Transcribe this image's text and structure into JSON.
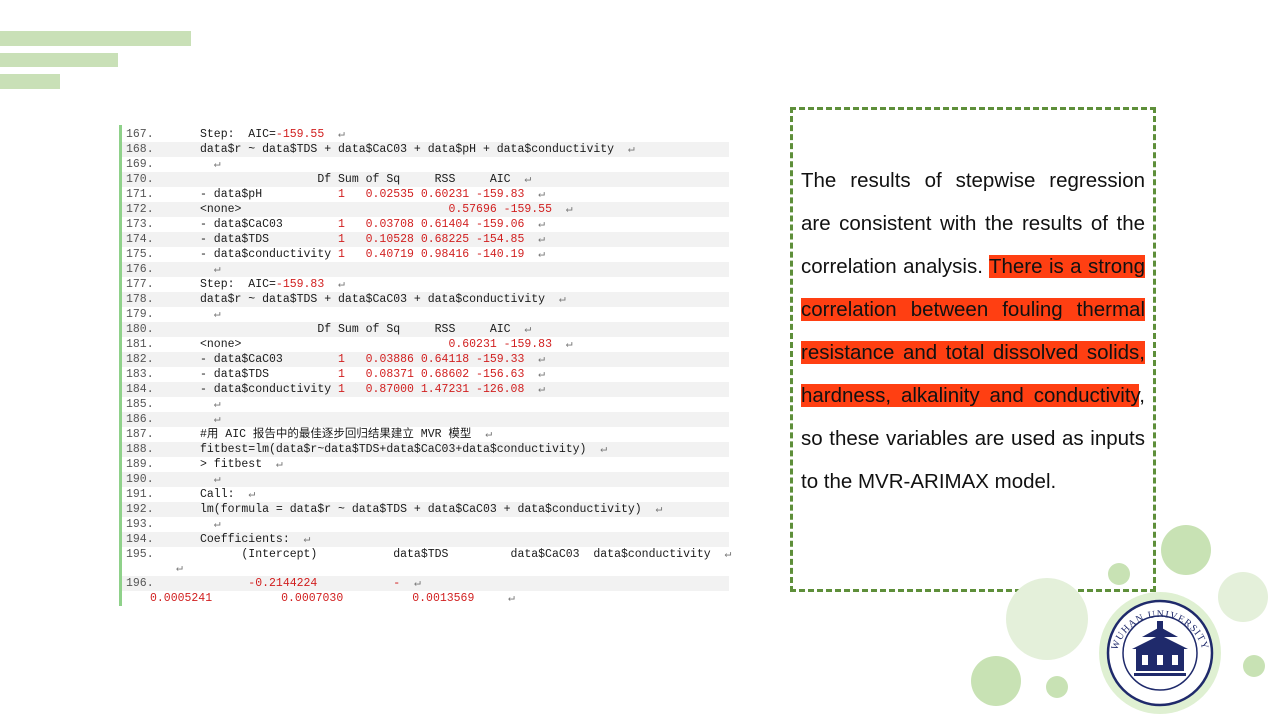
{
  "code_listing": {
    "lines": [
      {
        "num": "167.",
        "text": "Step:  AIC=",
        "red": "-159.55",
        "indent": 0
      },
      {
        "num": "168.",
        "text": "data$r ~ data$TDS + data$CaC03 + data$pH + data$conductivity",
        "indent": 0
      },
      {
        "num": "169.",
        "text": "",
        "indent": 0
      },
      {
        "num": "170.",
        "text": "                 Df Sum of Sq     RSS     AIC",
        "indent": 0
      },
      {
        "num": "171.",
        "text": "- data$pH",
        "red": "           1   0.02535 0.60231 -159.83",
        "indent": 0
      },
      {
        "num": "172.",
        "text": "<none>",
        "red": "                              0.57696 -159.55",
        "indent": 0
      },
      {
        "num": "173.",
        "text": "- data$CaC03",
        "red": "        1   0.03708 0.61404 -159.06",
        "indent": 0
      },
      {
        "num": "174.",
        "text": "- data$TDS",
        "red": "          1   0.10528 0.68225 -154.85",
        "indent": 0
      },
      {
        "num": "175.",
        "text": "- data$conductivity",
        "red": " 1   0.40719 0.98416 -140.19",
        "indent": 0
      },
      {
        "num": "176.",
        "text": "",
        "indent": 0
      },
      {
        "num": "177.",
        "text": "Step:  AIC=",
        "red": "-159.83",
        "indent": 0
      },
      {
        "num": "178.",
        "text": "data$r ~ data$TDS + data$CaC03 + data$conductivity",
        "indent": 0
      },
      {
        "num": "179.",
        "text": "",
        "indent": 0
      },
      {
        "num": "180.",
        "text": "                 Df Sum of Sq     RSS     AIC",
        "indent": 0
      },
      {
        "num": "181.",
        "text": "<none>",
        "red": "                              0.60231 -159.83",
        "indent": 0
      },
      {
        "num": "182.",
        "text": "- data$CaC03",
        "red": "        1   0.03886 0.64118 -159.33",
        "indent": 0
      },
      {
        "num": "183.",
        "text": "- data$TDS",
        "red": "          1   0.08371 0.68602 -156.63",
        "indent": 0
      },
      {
        "num": "184.",
        "text": "- data$conductivity",
        "red": " 1   0.87000 1.47231 -126.08",
        "indent": 0
      },
      {
        "num": "185.",
        "text": "",
        "indent": 0
      },
      {
        "num": "186.",
        "text": "",
        "indent": 0
      },
      {
        "num": "187.",
        "text": "#用 AIC 报告中的最佳逐步回归结果建立 MVR 模型",
        "indent": 0
      },
      {
        "num": "188.",
        "text": "fitbest=lm(data$r~data$TDS+data$CaC03+data$conductivity)",
        "indent": 0
      },
      {
        "num": "189.",
        "text": "> fitbest",
        "indent": 0
      },
      {
        "num": "190.",
        "text": "",
        "indent": 0
      },
      {
        "num": "191.",
        "text": "Call:",
        "indent": 0
      },
      {
        "num": "192.",
        "text": "lm(formula = data$r ~ data$TDS + data$CaC03 + data$conductivity)",
        "indent": 0
      },
      {
        "num": "193.",
        "text": "",
        "indent": 0
      },
      {
        "num": "194.",
        "text": "Coefficients:",
        "indent": 0
      },
      {
        "num": "195.",
        "text": "      (Intercept)           data$TDS         data$CaC03  data$conductivity",
        "indent": 0
      },
      {
        "num": "196.",
        "text": "",
        "red": "       -0.2144224           -",
        "indent": 0
      }
    ],
    "wrap_line": "0.0005241          0.0007030          0.0013569"
  },
  "description": {
    "text_before": "The results of stepwise regression are consistent with the results of the correlation analysis. ",
    "text_highlight": "There is a strong correlation between fouling thermal resistance and total dissolved solids, hardness, alkalinity and conductivity",
    "text_after": ", so these variables are used as inputs to the MVR-ARIMAX model."
  },
  "colors": {
    "highlight": "#ff3f12",
    "stripe": "#c9e0b7",
    "dashed_border": "#5e8f3a",
    "code_red": "#d11f1f",
    "circle_green": "#c8e2b4"
  },
  "logo": {
    "ring_text": "WUHAN UNIVERSITY",
    "icon": "wuhan-university-emblem"
  }
}
